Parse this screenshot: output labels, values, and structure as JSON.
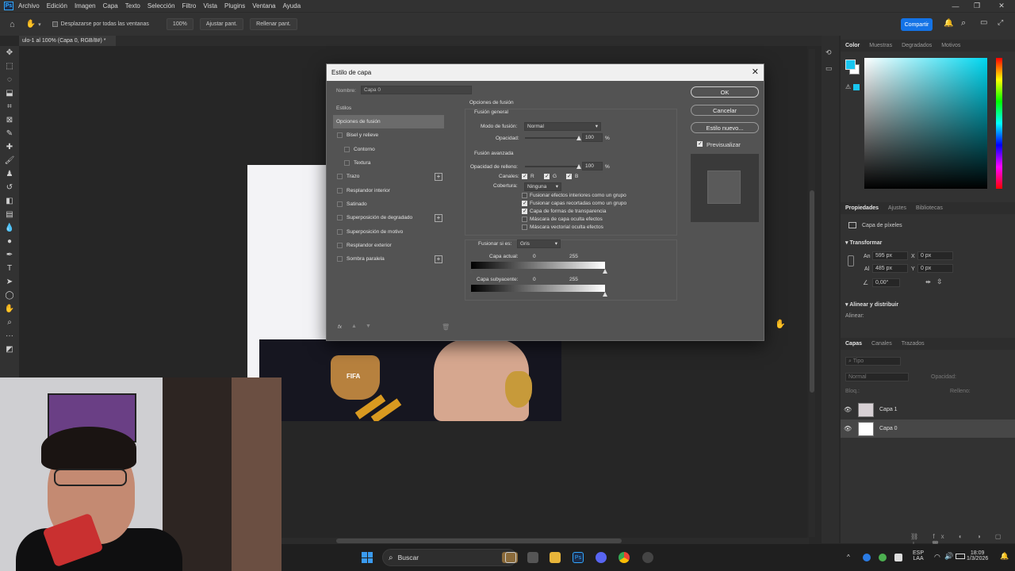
{
  "menubar": {
    "logo": "Ps",
    "items": [
      "Archivo",
      "Edición",
      "Imagen",
      "Capa",
      "Texto",
      "Selección",
      "Filtro",
      "Vista",
      "Plugins",
      "Ventana",
      "Ayuda"
    ]
  },
  "optionsbar": {
    "scroll_all_label": "Desplazarse por todas las ventanas",
    "zoom_value": "100%",
    "fit_screen": "Ajustar pant.",
    "fill_screen": "Rellenar pant.",
    "share": "Compartir"
  },
  "document": {
    "tab_title": "ulo-1 al 100% (Capa 0, RGB/8#) *",
    "shirt_text": "FIFA"
  },
  "dialog": {
    "title": "Estilo de capa",
    "name_label": "Nombre:",
    "name_value": "Capa 0",
    "styles_header": "Estilos",
    "styles": [
      {
        "label": "Opciones de fusión",
        "selected": true,
        "checkbox": false,
        "indent": false,
        "plus": false
      },
      {
        "label": "Bisel y relieve",
        "checkbox": true,
        "indent": false,
        "plus": false
      },
      {
        "label": "Contorno",
        "checkbox": true,
        "indent": true,
        "plus": false
      },
      {
        "label": "Textura",
        "checkbox": true,
        "indent": true,
        "plus": false
      },
      {
        "label": "Trazo",
        "checkbox": true,
        "indent": false,
        "plus": true
      },
      {
        "label": "Resplandor interior",
        "checkbox": true,
        "indent": false,
        "plus": false
      },
      {
        "label": "Satinado",
        "checkbox": true,
        "indent": false,
        "plus": false
      },
      {
        "label": "Superposición de degradado",
        "checkbox": true,
        "indent": false,
        "plus": true
      },
      {
        "label": "Superposición de motivo",
        "checkbox": true,
        "indent": false,
        "plus": false
      },
      {
        "label": "Resplandor exterior",
        "checkbox": true,
        "indent": false,
        "plus": false
      },
      {
        "label": "Sombra paralela",
        "checkbox": true,
        "indent": false,
        "plus": true
      }
    ],
    "fx_label": "fx",
    "blend_options_title": "Opciones de fusión",
    "general_title": "Fusión general",
    "blend_mode_label": "Modo de fusión:",
    "blend_mode_value": "Normal",
    "opacity_label": "Opacidad:",
    "opacity_value": "100",
    "opacity_level": 1.0,
    "percent": "%",
    "advanced_title": "Fusión avanzada",
    "fill_opacity_label": "Opacidad de relleno:",
    "fill_opacity_value": "100",
    "fill_opacity_level": 1.0,
    "channels_label": "Canales:",
    "channels": [
      "R",
      "G",
      "B"
    ],
    "knockout_label": "Cobertura:",
    "knockout_value": "Ninguna",
    "options": [
      {
        "label": "Fusionar efectos interiores como un grupo",
        "checked": false
      },
      {
        "label": "Fusionar capas recortadas como un grupo",
        "checked": true
      },
      {
        "label": "Capa de formas de transparencia",
        "checked": true
      },
      {
        "label": "Máscara de capa oculta efectos",
        "checked": false
      },
      {
        "label": "Máscara vectorial oculta efectos",
        "checked": false
      }
    ],
    "blend_if_label": "Fusionar si es:",
    "blend_if_value": "Gris",
    "this_layer_label": "Capa actual:",
    "this_layer_min": "0",
    "this_layer_max": "255",
    "underlying_label": "Capa subyacente:",
    "underlying_min": "0",
    "underlying_max": "255",
    "ok": "OK",
    "cancel": "Cancelar",
    "new_style": "Estilo nuevo...",
    "preview_label": "Previsualizar"
  },
  "color_panel": {
    "tabs": [
      "Color",
      "Muestras",
      "Degradados",
      "Motivos"
    ],
    "foreground": "#19c6f0",
    "background": "#ffffff"
  },
  "properties_panel": {
    "tabs": [
      "Propiedades",
      "Ajustes",
      "Bibliotecas"
    ],
    "layer_type": "Capa de píxeles",
    "transform_title": "Transformar",
    "w_label": "An",
    "w_value": "595 px",
    "h_label": "Al",
    "h_value": "485 px",
    "x_label": "X",
    "x_value": "0 px",
    "y_label": "Y",
    "y_value": "0 px",
    "angle_value": "0,00°",
    "align_title": "Alinear y distribuir",
    "align_label": "Alinear:"
  },
  "layers_panel": {
    "tabs": [
      "Capas",
      "Canales",
      "Trazados"
    ],
    "filter_placeholder": "Tipo",
    "blend_mode": "Normal",
    "opacity_label": "Opacidad:",
    "lock_label": "Bloq.:",
    "fill_label": "Relleno:",
    "layers": [
      {
        "name": "Capa 1",
        "selected": false
      },
      {
        "name": "Capa 0",
        "selected": true
      }
    ]
  },
  "taskbar": {
    "search": "Buscar",
    "lang1": "ESP",
    "lang2": "LAA",
    "time": "18:09",
    "date": "1/3/2026"
  }
}
